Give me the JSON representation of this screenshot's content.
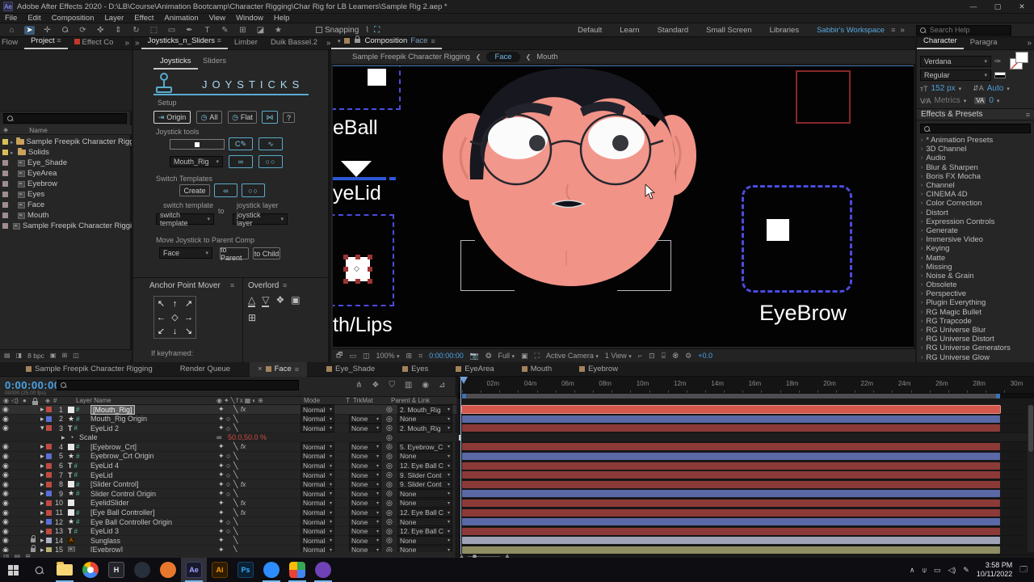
{
  "window": {
    "title": "Adobe After Effects 2020 - D:\\LB\\Course\\Animation Bootcamp\\Character Rigging\\Char Rig for LB Learners\\Sample Rig 2.aep *"
  },
  "menu": [
    "File",
    "Edit",
    "Composition",
    "Layer",
    "Effect",
    "Animation",
    "View",
    "Window",
    "Help"
  ],
  "toolbar": {
    "tools": [
      "home",
      "selection",
      "hand",
      "zoom",
      "orbit-camera",
      "pan-camera",
      "dolly-camera",
      "rotation",
      "region-of-interest",
      "rectangle",
      "pen",
      "type",
      "brush",
      "clone-stamp",
      "eraser",
      "motion-tracker"
    ],
    "active_tool": "selection",
    "snapping": "Snapping",
    "workspaces": [
      "Default",
      "Learn",
      "Standard",
      "Small Screen",
      "Libraries",
      "Sabbir's Workspace"
    ],
    "active_workspace": "Sabbir's Workspace",
    "search_placeholder": "Search Help"
  },
  "project": {
    "tabs": [
      "Flow",
      "Project",
      "Effect Co"
    ],
    "active_tab": "Project",
    "name_column": "Name",
    "items": [
      {
        "name": "Sample Freepik Character Rigging La",
        "type": "folder",
        "badge": true
      },
      {
        "name": "Solids",
        "type": "folder"
      },
      {
        "name": "Eye_Shade",
        "type": "comp"
      },
      {
        "name": "EyeArea",
        "type": "comp"
      },
      {
        "name": "Eyebrow",
        "type": "comp"
      },
      {
        "name": "Eyes",
        "type": "comp"
      },
      {
        "name": "Face",
        "type": "comp"
      },
      {
        "name": "Mouth",
        "type": "comp"
      },
      {
        "name": "Sample Freepik Character Rigging",
        "type": "comp"
      }
    ],
    "bit_depth": "8 bpc"
  },
  "joysticks": {
    "panel_tabs": [
      "Joysticks_n_Sliders",
      "Limber",
      "Duik Bassel.2"
    ],
    "active_panel_tab": "Joysticks_n_Sliders",
    "tabs": [
      "Joysticks",
      "Sliders"
    ],
    "active_tab": "Joysticks",
    "title": "JOYSTICKS",
    "setup": "Setup",
    "origin": "Origin",
    "all": "All",
    "flat": "Flat",
    "help": "?",
    "tools_label": "Joystick tools",
    "rig_select": "Mouth_Rig",
    "switch_templates": "Switch Templates",
    "create": "Create",
    "switch_template_label": "switch template",
    "to": "to",
    "joystick_layer_label": "joystick layer",
    "switch_select": "switch template",
    "layer_select": "joystick layer",
    "move_label": "Move Joystick to Parent Comp",
    "comp_select": "Face",
    "to_parent": "to Parent",
    "to_child": "to Child"
  },
  "anchor_mover": {
    "title": "Anchor Point Mover",
    "if_keyframed": "If keyframed:"
  },
  "overlord": {
    "title": "Overlord"
  },
  "composition": {
    "tab": "Composition",
    "comp_name": "Face",
    "breadcrumbs": [
      "Sample Freepik Character Rigging",
      "Face",
      "Mouth"
    ],
    "active_breadcrumb": "Face",
    "viewport_labels": {
      "eyeball": "eBall",
      "eyelid": "yeLid",
      "mouth_lips": "th/Lips",
      "eyebrow": "EyeBrow"
    },
    "toolbar": {
      "zoom": "100%",
      "timecode": "0:00:00:00",
      "resolution": "Full",
      "camera": "Active Camera",
      "views": "1 View",
      "exposure": "+0.0"
    }
  },
  "character": {
    "tabs": [
      "Character",
      "Paragra"
    ],
    "active_tab": "Character",
    "font_family": "Verdana",
    "font_style": "Regular",
    "font_size": "152 px",
    "leading": "Auto",
    "kerning": "Metrics",
    "tracking": "0"
  },
  "effects": {
    "title": "Effects & Presets",
    "categories": [
      "* Animation Presets",
      "3D Channel",
      "Audio",
      "Blur & Sharpen",
      "Boris FX Mocha",
      "Channel",
      "CINEMA 4D",
      "Color Correction",
      "Distort",
      "Expression Controls",
      "Generate",
      "Immersive Video",
      "Keying",
      "Matte",
      "Missing",
      "Noise & Grain",
      "Obsolete",
      "Perspective",
      "Plugin Everything",
      "RG Magic Bullet",
      "RG Trapcode",
      "RG Universe Blur",
      "RG Universe Distort",
      "RG Universe Generators",
      "RG Universe Glow"
    ]
  },
  "timeline": {
    "comp_tabs": [
      {
        "label": "Sample Freepik Character Rigging"
      },
      {
        "label": "Render Queue",
        "plain": true
      },
      {
        "label": "Face",
        "active": true
      },
      {
        "label": "Eye_Shade"
      },
      {
        "label": "Eyes"
      },
      {
        "label": "EyeArea"
      },
      {
        "label": "Mouth"
      },
      {
        "label": "Eyebrow"
      }
    ],
    "timecode": "0:00:00:00",
    "frame_info": "00000 (25.00 fps)",
    "columns": {
      "layer_name": "Layer Name",
      "mode": "Mode",
      "t": "T",
      "trkmat": "TrkMat",
      "parent": "Parent & Link"
    },
    "ruler_labels": [
      "02m",
      "04m",
      "06m",
      "08m",
      "10m",
      "12m",
      "14m",
      "16m",
      "18m",
      "20m",
      "22m",
      "24m",
      "26m",
      "28m",
      "30m"
    ],
    "layers": [
      {
        "num": 1,
        "name": "[Mouth_Rig]",
        "icon": "solid-hash",
        "chip": "#c04a42",
        "bar": "#d4574e",
        "mode": "Normal",
        "trkmat": "",
        "parent": "2. Mouth_Rig",
        "fx": true,
        "selected": true
      },
      {
        "num": 2,
        "name": "Mouth_Rig Origin",
        "icon": "star-hash",
        "chip": "#5b6fd6",
        "bar": "#5a68a6",
        "mode": "Normal",
        "trkmat": "None",
        "parent": "None",
        "circle": true
      },
      {
        "num": 3,
        "name": "EyeLid 2",
        "icon": "text-hash",
        "chip": "#c04a42",
        "bar": "#8c3a38",
        "mode": "Normal",
        "trkmat": "None",
        "parent": "2. Mouth_Rig",
        "circle": true,
        "expanded": true
      },
      {
        "num": 4,
        "name": "[Eyebrow_Crt]",
        "icon": "solid-hash",
        "chip": "#c04a42",
        "bar": "#8c3a38",
        "mode": "Normal",
        "trkmat": "None",
        "parent": "5. Eyebrow_C",
        "fx": true
      },
      {
        "num": 5,
        "name": "Eyebrow_Crt Origin",
        "icon": "star-hash",
        "chip": "#5b6fd6",
        "bar": "#5a68a6",
        "mode": "Normal",
        "trkmat": "None",
        "parent": "None",
        "circle": true
      },
      {
        "num": 6,
        "name": "EyeLid 4",
        "icon": "text-hash",
        "chip": "#c04a42",
        "bar": "#8c3a38",
        "mode": "Normal",
        "trkmat": "None",
        "parent": "12. Eye Ball C",
        "circle": true
      },
      {
        "num": 7,
        "name": "EyeLid",
        "icon": "text-hash",
        "chip": "#c04a42",
        "bar": "#8c3a38",
        "mode": "Normal",
        "trkmat": "None",
        "parent": "9. Slider Cont",
        "circle": true
      },
      {
        "num": 8,
        "name": "[Slider Control]",
        "icon": "solid-hash",
        "chip": "#c04a42",
        "bar": "#8c3a38",
        "mode": "Normal",
        "trkmat": "None",
        "parent": "9. Slider Cont",
        "fx": true,
        "circle": true
      },
      {
        "num": 9,
        "name": "Slider Control Origin",
        "icon": "star-hash",
        "chip": "#5b6fd6",
        "bar": "#5a68a6",
        "mode": "Normal",
        "trkmat": "None",
        "parent": "None",
        "circle": true
      },
      {
        "num": 10,
        "name": "EyelidSlider",
        "icon": "solid",
        "chip": "#c04a42",
        "bar": "#8c3a38",
        "mode": "Normal",
        "trkmat": "None",
        "parent": "None",
        "fx": true
      },
      {
        "num": 11,
        "name": "[Eye Ball Controller]",
        "icon": "solid-hash",
        "chip": "#c04a42",
        "bar": "#8c3a38",
        "mode": "Normal",
        "trkmat": "None",
        "parent": "12. Eye Ball C",
        "fx": true
      },
      {
        "num": 12,
        "name": "Eye Ball Controller Origin",
        "icon": "star-hash",
        "chip": "#5b6fd6",
        "bar": "#5a68a6",
        "mode": "Normal",
        "trkmat": "None",
        "parent": "None",
        "circle": true
      },
      {
        "num": 13,
        "name": "EyeLid 3",
        "icon": "text-hash",
        "chip": "#c04a42",
        "bar": "#8c3a38",
        "mode": "Normal",
        "trkmat": "None",
        "parent": "12. Eye Ball C",
        "circle": true
      },
      {
        "num": 14,
        "name": "Sunglass",
        "icon": "ai",
        "chip": "#aeb2c9",
        "bar": "#9fa3b5",
        "mode": "Normal",
        "trkmat": "None",
        "parent": "None",
        "locked": true
      },
      {
        "num": 15,
        "name": "[Eyebrow]",
        "icon": "comp",
        "chip": "#b8b273",
        "bar": "#8f8d63",
        "mode": "Normal",
        "trkmat": "None",
        "parent": "None",
        "locked": true
      }
    ],
    "property": {
      "name": "Scale",
      "value": "50.0,50.0 %"
    }
  },
  "taskbar": {
    "apps": [
      {
        "name": "file-explorer",
        "kind": "folder",
        "running": true
      },
      {
        "name": "chrome",
        "kind": "chrome"
      },
      {
        "name": "app-h",
        "kind": "letter",
        "label": "H",
        "bg": "#23232b",
        "fg": "#eaeaea"
      },
      {
        "name": "app-dark-circle",
        "kind": "circle",
        "color": "#262f3a"
      },
      {
        "name": "app-orange-circle",
        "kind": "circle",
        "color": "#e8772e"
      },
      {
        "name": "after-effects",
        "kind": "letter",
        "label": "Ae",
        "bg": "#19192e",
        "fg": "#9fa5ff",
        "active": true,
        "running": true
      },
      {
        "name": "illustrator",
        "kind": "letter",
        "label": "Ai",
        "bg": "#2e1c00",
        "fg": "#ff9a00"
      },
      {
        "name": "photoshop",
        "kind": "letter",
        "label": "Ps",
        "bg": "#0b2033",
        "fg": "#39abff"
      },
      {
        "name": "zoom",
        "kind": "circle",
        "color": "#2d8cff",
        "running": true
      },
      {
        "name": "camera-app",
        "kind": "gcam",
        "running": true
      },
      {
        "name": "media-player",
        "kind": "circle",
        "color": "#6f42b5",
        "running": true
      }
    ],
    "time": "3:58 PM",
    "date": "10/11/2022"
  },
  "colors": {
    "accent_blue": "#4f9fd8",
    "cyan": "#6fc2e0",
    "timecode_blue": "#4aa3e8",
    "value_red": "#cf4a42",
    "skin": "#f29387",
    "hair": "#17171f"
  }
}
